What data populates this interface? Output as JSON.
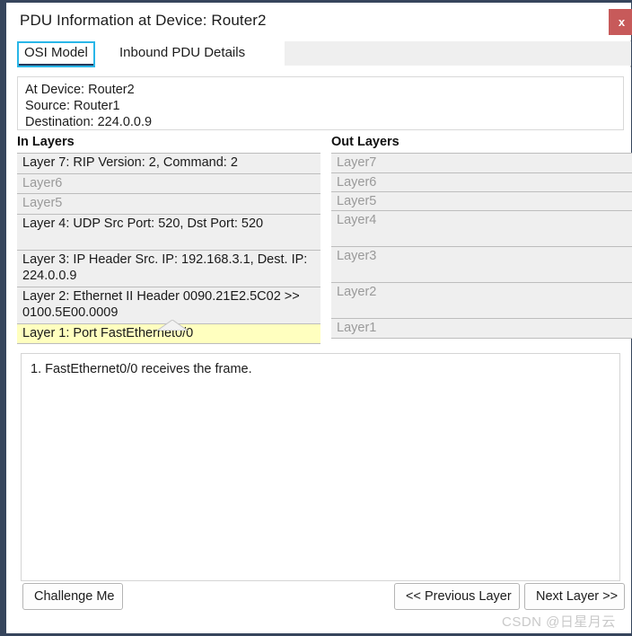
{
  "window": {
    "title": "PDU Information at Device: Router2",
    "close_label": "x",
    "accent_border": "#36455c",
    "close_color": "#c75a5a"
  },
  "tabs": [
    {
      "label": "OSI Model",
      "active": true
    },
    {
      "label": "Inbound PDU Details",
      "active": false
    }
  ],
  "info": {
    "at_device": "At Device: Router2",
    "source": "Source: Router1",
    "destination": "Destination: 224.0.0.9"
  },
  "in_layers": {
    "heading": "In Layers",
    "rows": [
      {
        "text": "Layer 7: RIP Version: 2, Command: 2",
        "state": "normal"
      },
      {
        "text": "Layer6",
        "state": "dim"
      },
      {
        "text": "Layer5",
        "state": "dim"
      },
      {
        "text": "Layer 4: UDP Src Port: 520, Dst Port: 520",
        "state": "normal"
      },
      {
        "text": "Layer 3: IP Header Src. IP: 192.168.3.1, Dest. IP: 224.0.0.9",
        "state": "normal"
      },
      {
        "text": "Layer 2: Ethernet II Header 0090.21E2.5C02 >> 0100.5E00.0009",
        "state": "normal"
      },
      {
        "text": "Layer 1: Port FastEthernet0/0",
        "state": "selected"
      }
    ]
  },
  "out_layers": {
    "heading": "Out Layers",
    "rows": [
      {
        "text": "Layer7",
        "state": "dim"
      },
      {
        "text": "Layer6",
        "state": "dim"
      },
      {
        "text": "Layer5",
        "state": "dim"
      },
      {
        "text": "Layer4",
        "state": "dim"
      },
      {
        "text": "Layer3",
        "state": "dim"
      },
      {
        "text": "Layer2",
        "state": "dim"
      },
      {
        "text": "Layer1",
        "state": "dim"
      }
    ]
  },
  "description": {
    "lines": [
      "1. FastEthernet0/0 receives the frame."
    ]
  },
  "buttons": {
    "challenge": "Challenge Me",
    "previous": "<< Previous Layer",
    "next": "Next Layer >>"
  },
  "watermark": "CSDN @日星月云",
  "icons": {
    "close": "close-icon",
    "collapse": "chevron-up-icon"
  }
}
